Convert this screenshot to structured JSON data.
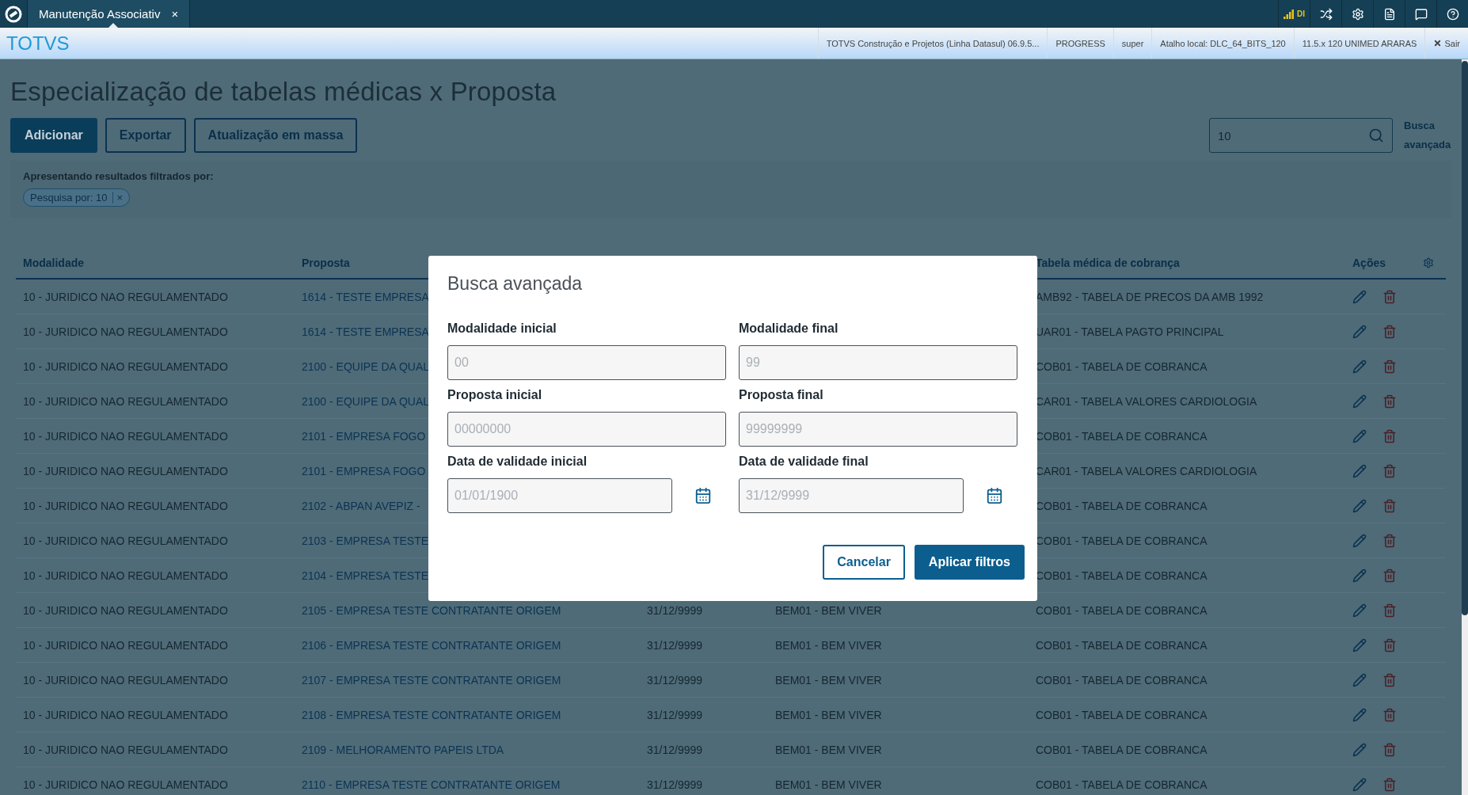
{
  "topbar": {
    "tab": {
      "label": "Manutenção Associativ",
      "close": "×",
      "selected": true
    },
    "signal_label": "DI"
  },
  "header": {
    "brand": "TOTVS",
    "info": [
      "TOTVS Construção e Projetos (Linha Datasul) 06.9.5...",
      "PROGRESS",
      "super",
      "Atalho local: DLC_64_BITS_120",
      "11.5.x 120 UNIMED ARARAS"
    ],
    "logout": "Sair"
  },
  "page": {
    "title": "Especialização de tabelas médicas x Proposta",
    "buttons": [
      {
        "label": "Adicionar",
        "kind": "primary"
      },
      {
        "label": "Exportar",
        "kind": "secondary"
      },
      {
        "label": "Atualização em massa",
        "kind": "secondary"
      }
    ],
    "search": {
      "value": "10"
    },
    "advanced_search_link": "Busca avançada",
    "filters": {
      "label": "Apresentando resultados filtrados por:",
      "chips": [
        {
          "label": "Pesquisa por: 10",
          "remove": "×"
        }
      ]
    }
  },
  "table": {
    "columns": [
      "Modalidade",
      "Proposta",
      null,
      null,
      "Tabela médica de cobrança",
      "Ações"
    ],
    "rows": [
      [
        "10 - JURIDICO NAO REGULAMENTADO",
        "1614 - TESTE EMPRESA",
        null,
        null,
        "AMB92 - TABELA DE PRECOS DA AMB 1992"
      ],
      [
        "10 - JURIDICO NAO REGULAMENTADO",
        "1614 - TESTE EMPRESA",
        null,
        null,
        "UAR01 - TABELA PAGTO PRINCIPAL"
      ],
      [
        "10 - JURIDICO NAO REGULAMENTADO",
        "2100 - EQUIPE DA QUAL",
        null,
        null,
        "COB01 - TABELA DE COBRANCA"
      ],
      [
        "10 - JURIDICO NAO REGULAMENTADO",
        "2100 - EQUIPE DA QUAL",
        null,
        null,
        "CAR01 - TABELA VALORES CARDIOLOGIA"
      ],
      [
        "10 - JURIDICO NAO REGULAMENTADO",
        "2101 - EMPRESA FOGO",
        null,
        null,
        "COB01 - TABELA DE COBRANCA"
      ],
      [
        "10 - JURIDICO NAO REGULAMENTADO",
        "2101 - EMPRESA FOGO",
        null,
        null,
        "CAR01 - TABELA VALORES CARDIOLOGIA"
      ],
      [
        "10 - JURIDICO NAO REGULAMENTADO",
        "2102 - ABPAN AVEPIZ -",
        null,
        null,
        "COB01 - TABELA DE COBRANCA"
      ],
      [
        "10 - JURIDICO NAO REGULAMENTADO",
        "2103 - EMPRESA TESTE",
        null,
        null,
        "COB01 - TABELA DE COBRANCA"
      ],
      [
        "10 - JURIDICO NAO REGULAMENTADO",
        "2104 - EMPRESA TESTE",
        null,
        null,
        "COB01 - TABELA DE COBRANCA"
      ],
      [
        "10 - JURIDICO NAO REGULAMENTADO",
        "2105 - EMPRESA TESTE CONTRATANTE ORIGEM",
        "31/12/9999",
        "BEM01 - BEM VIVER",
        "COB01 - TABELA DE COBRANCA"
      ],
      [
        "10 - JURIDICO NAO REGULAMENTADO",
        "2106 - EMPRESA TESTE CONTRATANTE ORIGEM",
        "31/12/9999",
        "BEM01 - BEM VIVER",
        "COB01 - TABELA DE COBRANCA"
      ],
      [
        "10 - JURIDICO NAO REGULAMENTADO",
        "2107 - EMPRESA TESTE CONTRATANTE ORIGEM",
        "31/12/9999",
        "BEM01 - BEM VIVER",
        "COB01 - TABELA DE COBRANCA"
      ],
      [
        "10 - JURIDICO NAO REGULAMENTADO",
        "2108 - EMPRESA TESTE CONTRATANTE ORIGEM",
        "31/12/9999",
        "BEM01 - BEM VIVER",
        "COB01 - TABELA DE COBRANCA"
      ],
      [
        "10 - JURIDICO NAO REGULAMENTADO",
        "2109 - MELHORAMENTO PAPEIS LTDA",
        "31/12/9999",
        "BEM01 - BEM VIVER",
        "COB01 - TABELA DE COBRANCA"
      ],
      [
        "10 - JURIDICO NAO REGULAMENTADO",
        "2110 - EMPRESA TESTE CONTRATANTE ORIGEM",
        "31/12/9999",
        "BEM01 - BEM VIVER",
        "COB01 - TABELA DE COBRANCA"
      ]
    ]
  },
  "modal": {
    "title": "Busca avançada",
    "fields": [
      {
        "label": "Modalidade inicial",
        "placeholder": "00",
        "kind": "text"
      },
      {
        "label": "Modalidade final",
        "placeholder": "99",
        "kind": "text"
      },
      {
        "label": "Proposta inicial",
        "placeholder": "00000000",
        "kind": "text"
      },
      {
        "label": "Proposta final",
        "placeholder": "99999999",
        "kind": "text"
      },
      {
        "label": "Data de validade inicial",
        "placeholder": "01/01/1900",
        "kind": "date"
      },
      {
        "label": "Data de validade final",
        "placeholder": "31/12/9999",
        "kind": "date"
      }
    ],
    "buttons": [
      {
        "label": "Cancelar",
        "kind": "secondary"
      },
      {
        "label": "Aplicar filtros",
        "kind": "primary"
      }
    ]
  }
}
